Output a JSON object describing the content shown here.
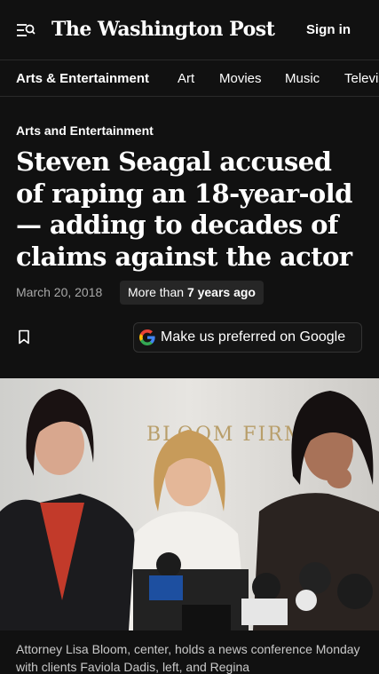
{
  "header": {
    "logo_text": "The Washington Post",
    "signin_label": "Sign in",
    "menu_icon": "menu-search-icon"
  },
  "nav": {
    "items": [
      "Arts & Entertainment",
      "Art",
      "Movies",
      "Music",
      "Televis"
    ]
  },
  "article": {
    "kicker": "Arts and Entertainment",
    "headline": "Steven Seagal accused of raping an 18-year-old — adding to decades of claims against the actor",
    "date": "March 20, 2018",
    "age_prefix": "More than ",
    "age_value": "7 years ago",
    "bookmark_icon": "bookmark-icon",
    "google_button_label": "Make us preferred on Google",
    "photo_sign_text": "BLOOM FIRM",
    "caption": "Attorney Lisa Bloom, center, holds a news conference Monday with clients Faviola Dadis, left, and Regina"
  },
  "colors": {
    "background": "#111111",
    "muted_text": "#a8a8a8",
    "badge_bg": "#262626"
  }
}
